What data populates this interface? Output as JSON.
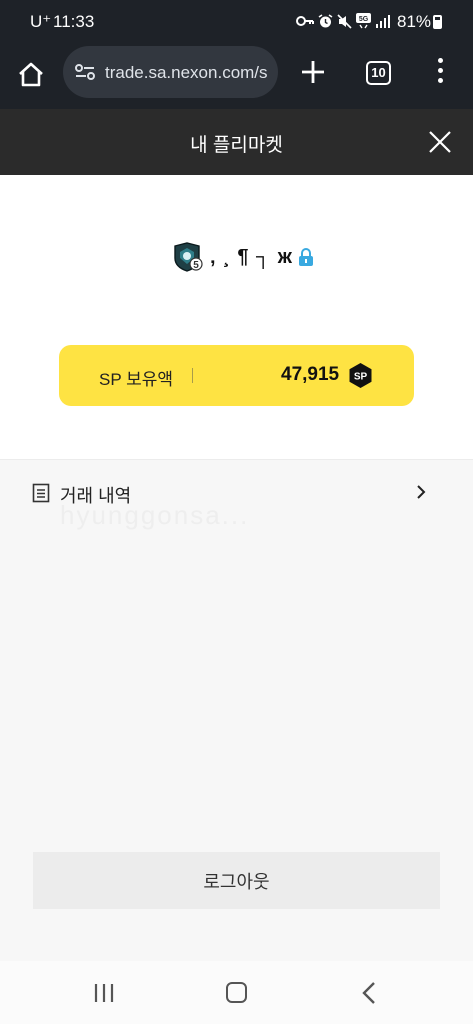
{
  "status_bar": {
    "carrier": "U⁺",
    "time": "11:33",
    "icons": [
      "key-icon",
      "alarm-icon",
      "mute-icon",
      "5g-icon",
      "signal-icon"
    ],
    "battery": "81%"
  },
  "browser": {
    "url": "trade.sa.nexon.com/s",
    "tab_count": "10"
  },
  "header": {
    "title": "내 플리마켓"
  },
  "profile": {
    "rank_badge": "5",
    "nickname": "‚ ¸ ¶ ┐ ж"
  },
  "sp": {
    "label": "SP 보유액",
    "value": "47,915",
    "badge": "SP",
    "color": "#fee343"
  },
  "list": {
    "items": [
      {
        "label": "거래 내역"
      }
    ],
    "watermark": "hyunggonsa..."
  },
  "logout_label": "로그아웃"
}
